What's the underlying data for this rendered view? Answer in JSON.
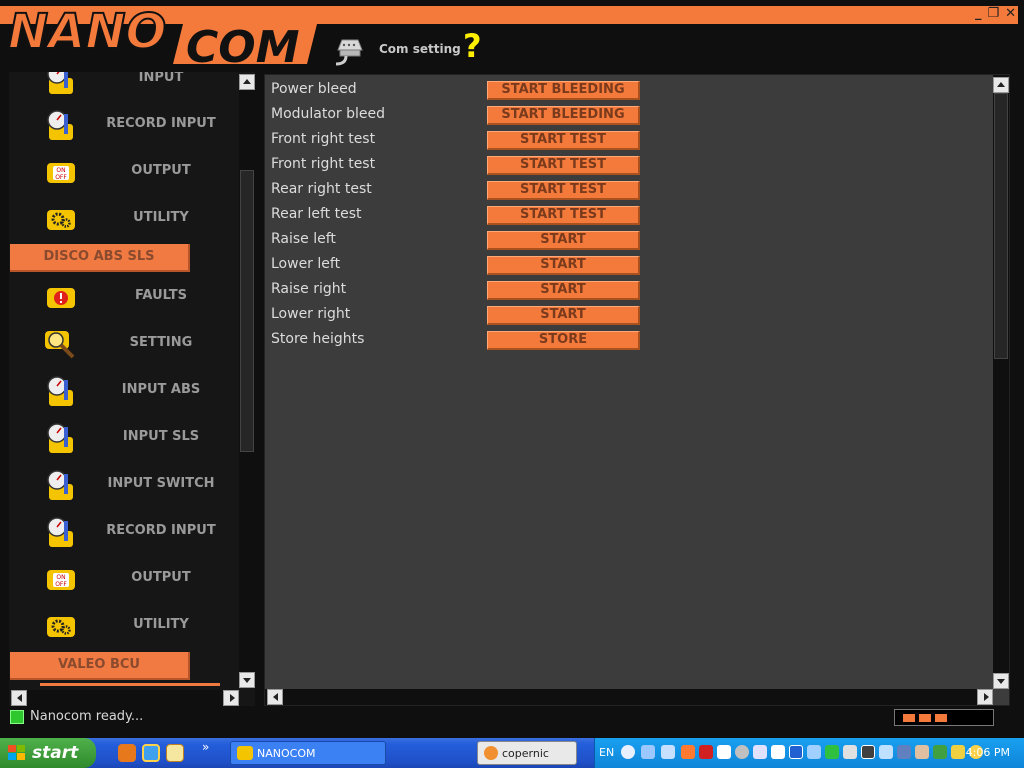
{
  "app": {
    "logo_part1": "NANO",
    "logo_part2": "COM",
    "com_setting_label": "Com setting",
    "help_symbol": "?",
    "window_controls": [
      "_",
      "❐",
      "✕"
    ]
  },
  "sidebar": {
    "items": [
      {
        "label": "INPUT",
        "icon": "gauge-input-icon"
      },
      {
        "label": "RECORD INPUT",
        "icon": "gauge-input-icon"
      },
      {
        "label": "OUTPUT",
        "icon": "on-off-icon"
      },
      {
        "label": "UTILITY",
        "icon": "gear-utility-icon"
      },
      {
        "section": "DISCO ABS SLS"
      },
      {
        "label": "FAULTS",
        "icon": "fault-warning-icon"
      },
      {
        "label": "SETTING",
        "icon": "setting-magnifier-icon"
      },
      {
        "label": "INPUT ABS",
        "icon": "gauge-input-icon"
      },
      {
        "label": "INPUT SLS",
        "icon": "gauge-input-icon"
      },
      {
        "label": "INPUT SWITCH",
        "icon": "gauge-input-icon"
      },
      {
        "label": "RECORD INPUT",
        "icon": "gauge-input-icon"
      },
      {
        "label": "OUTPUT",
        "icon": "on-off-icon"
      },
      {
        "label": "UTILITY",
        "icon": "gear-utility-icon"
      },
      {
        "section": "VALEO BCU"
      }
    ]
  },
  "main": {
    "rows": [
      {
        "label": "Power bleed",
        "button": "START BLEEDING"
      },
      {
        "label": "Modulator bleed",
        "button": "START BLEEDING"
      },
      {
        "label": "Front right test",
        "button": "START TEST"
      },
      {
        "label": "Front right test",
        "button": "START TEST"
      },
      {
        "label": "Rear right test",
        "button": "START TEST"
      },
      {
        "label": "Rear left test",
        "button": "START TEST"
      },
      {
        "label": "Raise left",
        "button": "START"
      },
      {
        "label": "Lower left",
        "button": "START"
      },
      {
        "label": "Raise right",
        "button": "START"
      },
      {
        "label": "Lower right",
        "button": "START"
      },
      {
        "label": "Store heights",
        "button": "STORE"
      }
    ]
  },
  "status": {
    "text": "Nanocom ready...",
    "light_color": "#2ec82e"
  },
  "colors": {
    "accent": "#f47a3c",
    "background": "#0f0f0f",
    "panel": "#3c3c3c"
  },
  "taskbar": {
    "start_label": "start",
    "tasks": [
      {
        "label": "NANOCOM",
        "icon": "nanocom-app-icon"
      },
      {
        "label": "copernic",
        "icon": "copernic-app-icon"
      }
    ],
    "lang": "EN",
    "clock": "4:06 PM",
    "quick_launch_more": "»"
  }
}
